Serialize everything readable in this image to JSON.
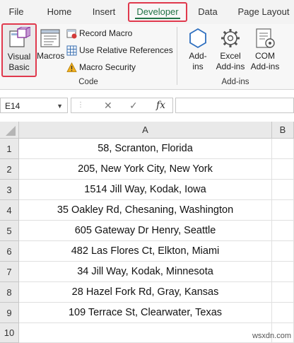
{
  "ribbon_tabs": [
    "File",
    "Home",
    "Insert",
    "Developer",
    "Data",
    "Page Layout"
  ],
  "active_tab": "Developer",
  "code_group": {
    "visual_basic": {
      "line1": "Visual",
      "line2": "Basic"
    },
    "macros": "Macros",
    "record_macro": "Record Macro",
    "use_relative_references": "Use Relative References",
    "macro_security": "Macro Security",
    "label": "Code"
  },
  "addins_group": {
    "addins": {
      "line1": "Add-",
      "line2": "ins"
    },
    "excel_addins": {
      "line1": "Excel",
      "line2": "Add-ins"
    },
    "com_addins": {
      "line1": "COM",
      "line2": "Add-ins"
    },
    "label": "Add-ins"
  },
  "formula_bar": {
    "name_box": "E14",
    "cancel_symbol": "✕",
    "enter_symbol": "✓",
    "fx_symbol": "fx",
    "formula": ""
  },
  "columns": [
    "A",
    "B"
  ],
  "rows": [
    {
      "num": "1",
      "a": "58, Scranton, Florida"
    },
    {
      "num": "2",
      "a": "205, New York City, New York"
    },
    {
      "num": "3",
      "a": "1514 Jill Way, Kodak, Iowa"
    },
    {
      "num": "4",
      "a": "35 Oakley Rd, Chesaning, Washington"
    },
    {
      "num": "5",
      "a": "605 Gateway Dr Henry, Seattle"
    },
    {
      "num": "6",
      "a": "482 Las Flores Ct, Elkton, Miami"
    },
    {
      "num": "7",
      "a": "34 Jill Way, Kodak, Minnesota"
    },
    {
      "num": "8",
      "a": "28 Hazel Fork Rd, Gray, Kansas"
    },
    {
      "num": "9",
      "a": "109 Terrace St, Clearwater, Texas"
    },
    {
      "num": "10",
      "a": ""
    }
  ],
  "watermark": "wsxdn.com",
  "colors": {
    "accent_green": "#217346",
    "highlight_red": "#e0394d"
  }
}
